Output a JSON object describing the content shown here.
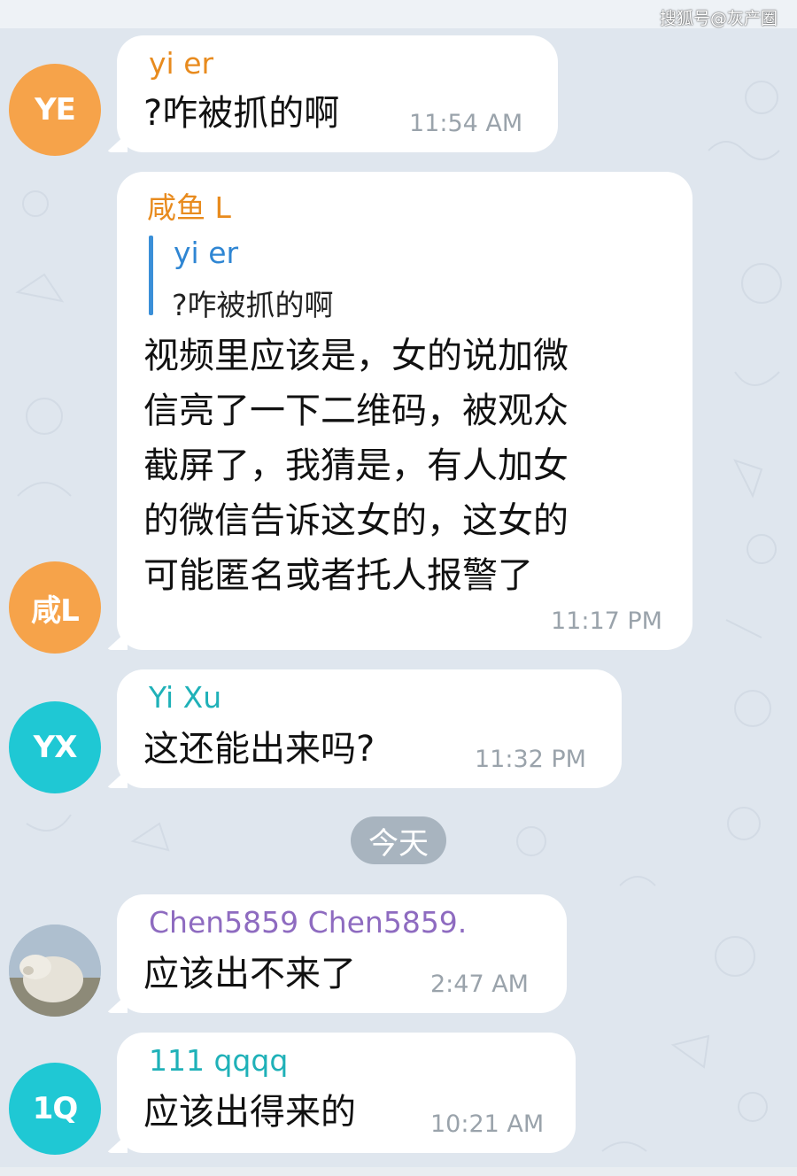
{
  "watermark": "搜狐号@灰产圈",
  "date_divider": "今天",
  "colors": {
    "background": "#dfe6ee",
    "bubble": "#ffffff",
    "reply_bar": "#3a8fd8"
  },
  "messages": [
    {
      "avatar_text": "YE",
      "avatar_color": "#f6a34a",
      "sender": "yi er",
      "sender_color": "#e88b1e",
      "text": "?咋被抓的啊",
      "time": "11:54 AM"
    },
    {
      "avatar_text": "咸L",
      "avatar_color": "#f6a34a",
      "sender": "咸鱼 L",
      "sender_color": "#e88b1e",
      "reply": {
        "name": "yi er",
        "text": "?咋被抓的啊"
      },
      "lines": [
        "视频里应该是，女的说加微",
        "信亮了一下二维码，被观众",
        "截屏了，我猜是，有人加女",
        "的微信告诉这女的，这女的",
        "可能匿名或者托人报警了"
      ],
      "time": "11:17 PM"
    },
    {
      "avatar_text": "YX",
      "avatar_color": "#1fc8d4",
      "sender": "Yi Xu",
      "sender_color": "#1fb1b8",
      "text": "这还能出来吗?",
      "time": "11:32 PM"
    },
    {
      "avatar_text": "",
      "avatar_color": "#9fb7cf",
      "sender": "Chen5859 Chen5859.",
      "sender_color": "#8e6bc0",
      "text": "应该出不来了",
      "time": "2:47 AM"
    },
    {
      "avatar_text": "1Q",
      "avatar_color": "#1fc8d4",
      "sender": "111 qqqq",
      "sender_color": "#1fb1b8",
      "text": "应该出得来的",
      "time": "10:21 AM"
    }
  ]
}
